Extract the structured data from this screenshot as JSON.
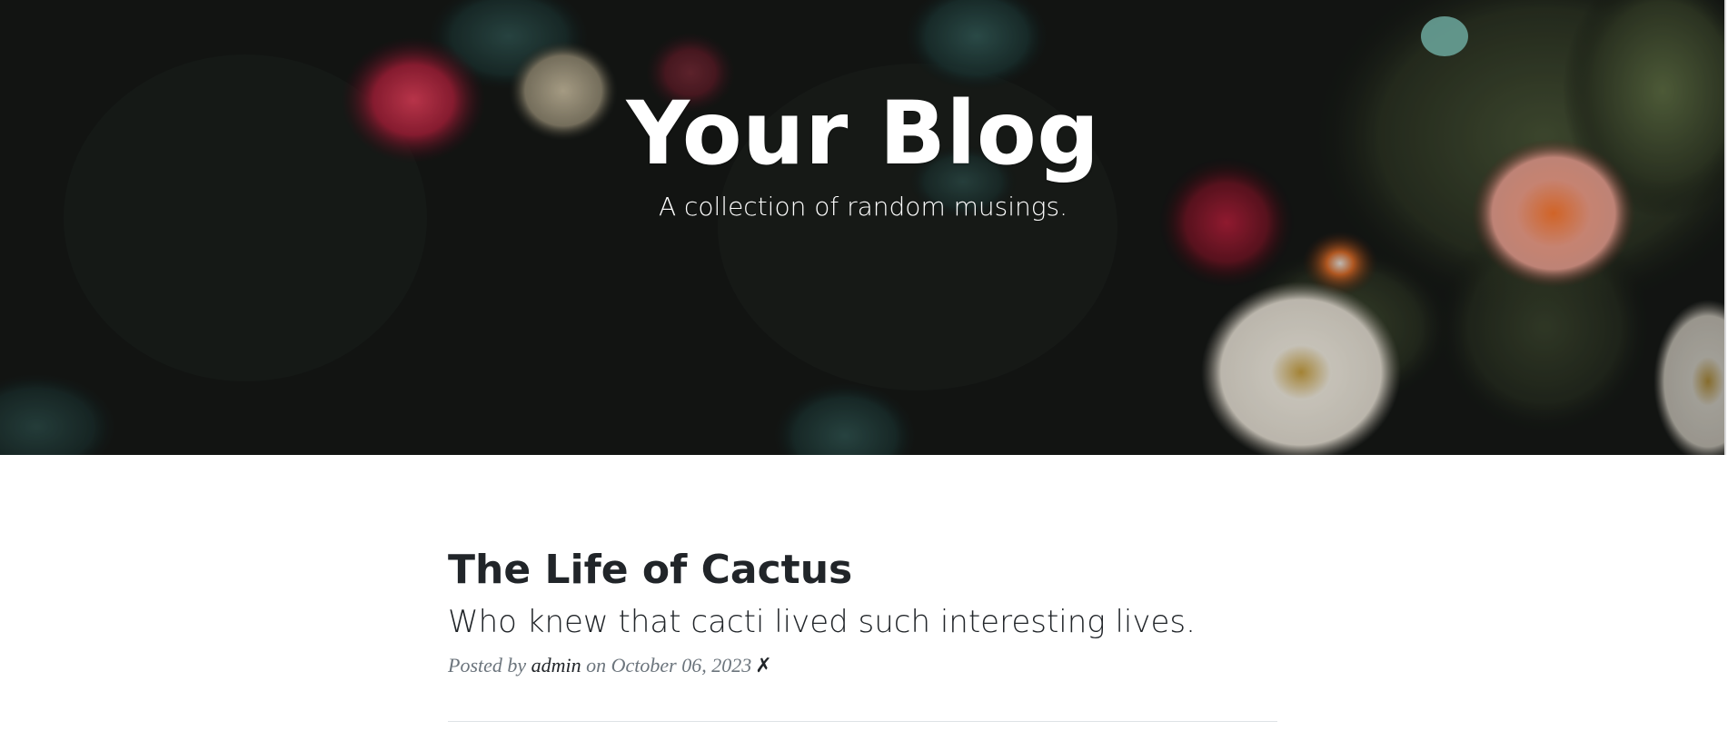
{
  "header": {
    "title": "Your Blog",
    "subtitle": "A collection of random musings."
  },
  "posts": [
    {
      "title": "The Life of Cactus",
      "subtitle": "Who knew that cacti lived such interesting lives.",
      "meta_prefix": "Posted by",
      "author": "admin",
      "meta_on": "on",
      "date": "October 06, 2023",
      "delete_icon": "✗"
    }
  ],
  "colors": {
    "heading_text": "#212529",
    "meta_text": "#6c757d",
    "masthead_text": "#ffffff"
  }
}
